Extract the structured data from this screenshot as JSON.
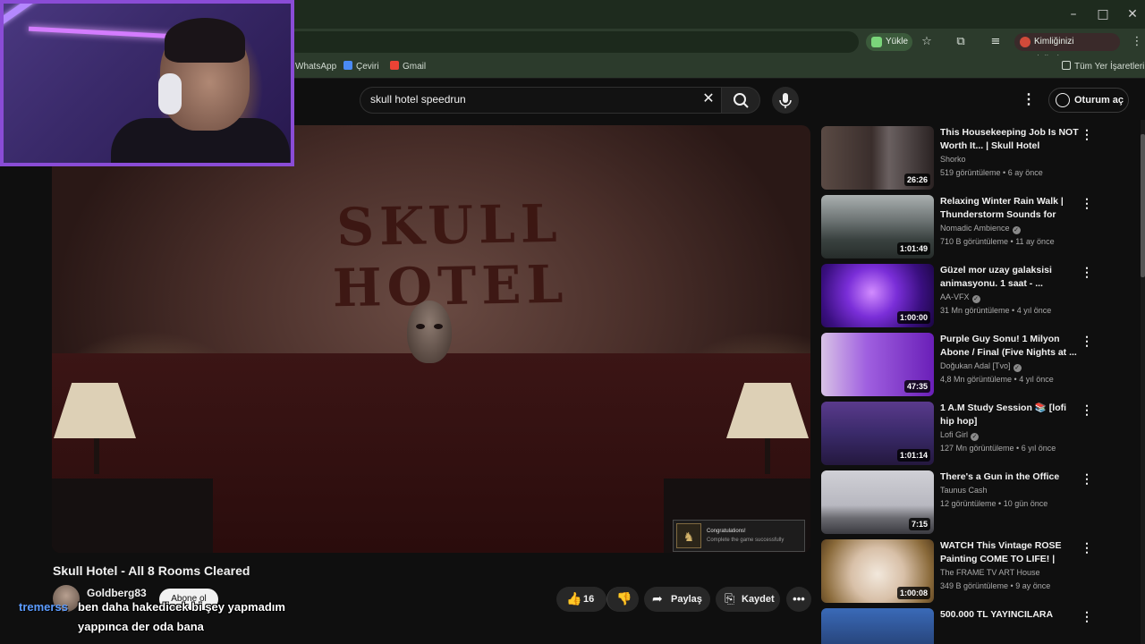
{
  "browser": {
    "install_label": "Yükle",
    "profile_label": "Kimliğinizi doğrulayın",
    "bookmarks": [
      {
        "label": "WhatsApp"
      },
      {
        "label": "Çeviri"
      },
      {
        "label": "Gmail"
      }
    ],
    "all_bookmarks_label": "Tüm Yer İşaretleri"
  },
  "youtube": {
    "search_query": "skull hotel speedrun",
    "sign_in_label": "Oturum aç"
  },
  "player": {
    "scene_sign": "SKULL HOTEL",
    "achievement_title": "Congratulations!",
    "achievement_desc": "Complete the game successfully"
  },
  "video": {
    "title": "Skull Hotel - All 8 Rooms Cleared",
    "channel": "Goldberg83",
    "subscribe_label": "Abone ol",
    "likes": "16",
    "share_label": "Paylaş",
    "save_label": "Kaydet"
  },
  "chat": {
    "username": "tremerss",
    "line1": "ben daha hakedicek bi şey yapmadım",
    "line2": "yappınca der oda bana"
  },
  "recommendations": [
    {
      "title": "This Housekeeping Job Is NOT Worth It... | Skull Hotel",
      "channel": "Shorko",
      "verified": false,
      "meta": "519 görüntüleme • 6 ay önce",
      "duration": "26:26",
      "thumb": "linear-gradient(90deg,#5a4a44 0%,#3a2e2c 45%,#6a6060 60%,#2a2222 100%)"
    },
    {
      "title": "Relaxing Winter Rain Walk | Thunderstorm Sounds for Slee...",
      "channel": "Nomadic Ambience",
      "verified": true,
      "meta": "710 B görüntüleme • 11 ay önce",
      "duration": "1:01:49",
      "thumb": "linear-gradient(180deg,#aab0b0 0%,#6d7474 40%,#3a4240 70%,#262c2a 100%)"
    },
    {
      "title": "Güzel mor uzay galaksisi animasyonu. 1 saat - ...",
      "channel": "AA-VFX",
      "verified": true,
      "meta": "31 Mn görüntüleme • 4 yıl önce",
      "duration": "1:00:00",
      "thumb": "radial-gradient(circle at 45% 45%,#d28cff 0%,#7a2ed8 35%,#3a0f80 70%,#1a0640 100%)"
    },
    {
      "title": "Purple Guy Sonu! 1 Milyon Abone / Final (Five Nights at ...",
      "channel": "Doğukan Adal [Tvo]",
      "verified": true,
      "meta": "4,8 Mn görüntüleme • 4 yıl önce",
      "duration": "47:35",
      "thumb": "linear-gradient(90deg,#d8c2e6 0%,#a060e0 40%,#6a1fb8 100%)"
    },
    {
      "title": "1 A.M Study Session 📚 [lofi hip hop]",
      "channel": "Lofi Girl",
      "verified": true,
      "meta": "127 Mn görüntüleme • 6 yıl önce",
      "duration": "1:01:14",
      "thumb": "linear-gradient(180deg,#5a3a8c 0%,#3a2a6a 50%,#24183e 100%)"
    },
    {
      "title": "There's a Gun in the Office",
      "channel": "Taunus Cash",
      "verified": false,
      "meta": "12 görüntüleme • 10 gün önce",
      "duration": "7:15",
      "thumb": "linear-gradient(180deg,#d0d0d6 0%,#b8b8c0 55%,#6a6a70 75%,#3a3a40 100%)"
    },
    {
      "title": "WATCH This Vintage ROSE Painting COME TO LIFE! | Gold...",
      "channel": "The FRAME TV ART House",
      "verified": false,
      "meta": "349 B görüntüleme • 9 ay önce",
      "duration": "1:00:08",
      "thumb": "radial-gradient(circle at 50% 55%,#f2e8dc 0%,#d8c0a8 40%,#8a6a3a 80%,#5a4020 100%)"
    },
    {
      "title": "500.000 TL YAYINCILARA",
      "channel": "",
      "verified": false,
      "meta": "",
      "duration": "",
      "thumb": "linear-gradient(180deg,#3a6ab8 0%,#1a2a50 100%)"
    }
  ]
}
